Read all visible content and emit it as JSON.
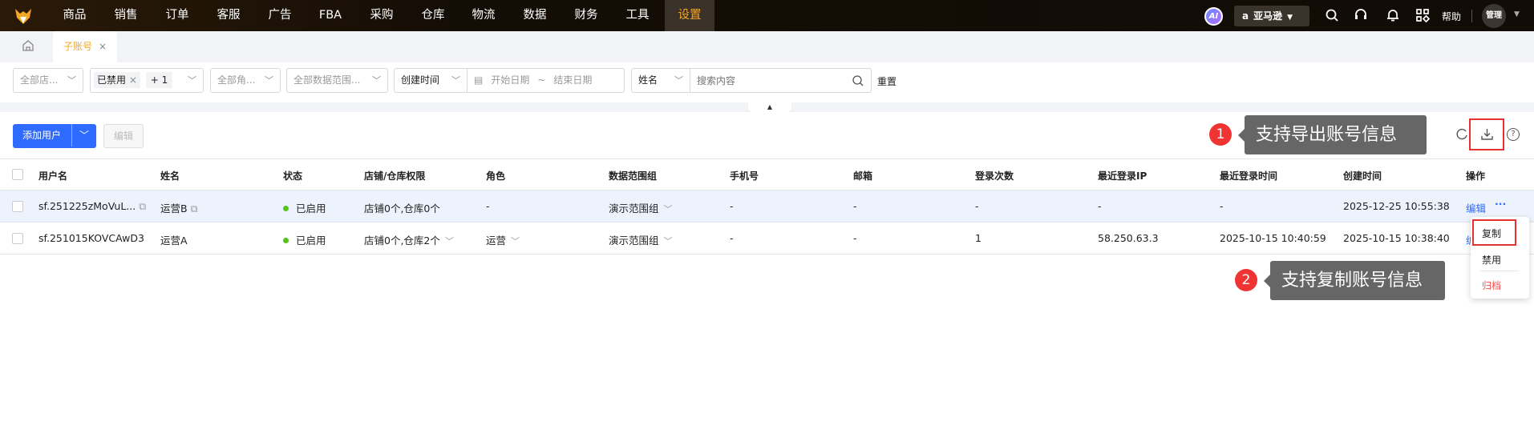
{
  "nav": {
    "items": [
      "商品",
      "销售",
      "订单",
      "客服",
      "广告",
      "FBA",
      "采购",
      "仓库",
      "物流",
      "数据",
      "财务",
      "工具",
      "设置"
    ],
    "active": "设置",
    "ai": "AI",
    "platform": "亚马逊",
    "help": "帮助",
    "user": "管理"
  },
  "tabs": {
    "current": "子账号"
  },
  "filters": {
    "store": "全部店...",
    "status_tag": "已禁用",
    "status_more": "+ 1",
    "role": "全部角...",
    "scope": "全部数据范围...",
    "time_type": "创建时间",
    "start": "开始日期",
    "sep": "~",
    "end": "结束日期",
    "field": "姓名",
    "search_placeholder": "搜索内容",
    "reset": "重置"
  },
  "toolbar": {
    "add": "添加用户",
    "edit": "编辑"
  },
  "table": {
    "headers": [
      "用户名",
      "姓名",
      "状态",
      "店铺/仓库权限",
      "角色",
      "数据范围组",
      "手机号",
      "邮箱",
      "登录次数",
      "最近登录IP",
      "最近登录时间",
      "创建时间",
      "操作"
    ],
    "rows": [
      {
        "username": "sf.251225zMoVuL...",
        "name": "运营B",
        "status": "已启用",
        "perm": "店铺0个,仓库0个",
        "role": "-",
        "scope": "演示范围组",
        "phone": "-",
        "email": "-",
        "logins": "-",
        "ip": "-",
        "last_login": "-",
        "created": "2025-12-25 10:55:38",
        "edit": "编辑",
        "more": "···"
      },
      {
        "username": "sf.251015KOVCAwD3",
        "name": "运营A",
        "status": "已启用",
        "perm": "店铺0个,仓库2个",
        "role": "运营",
        "scope": "演示范围组",
        "phone": "-",
        "email": "-",
        "logins": "1",
        "ip": "58.250.63.3",
        "last_login": "2025-10-15 10:40:59",
        "created": "2025-10-15 10:38:40",
        "edit": "编"
      }
    ]
  },
  "menu": {
    "copy": "复制",
    "disable": "禁用",
    "archive": "归档"
  },
  "annotations": [
    {
      "num": "1",
      "text": "支持导出账号信息"
    },
    {
      "num": "2",
      "text": "支持复制账号信息"
    }
  ],
  "colors": {
    "primary": "#2f6bff",
    "accent": "#f5a623",
    "danger": "#f03434"
  }
}
